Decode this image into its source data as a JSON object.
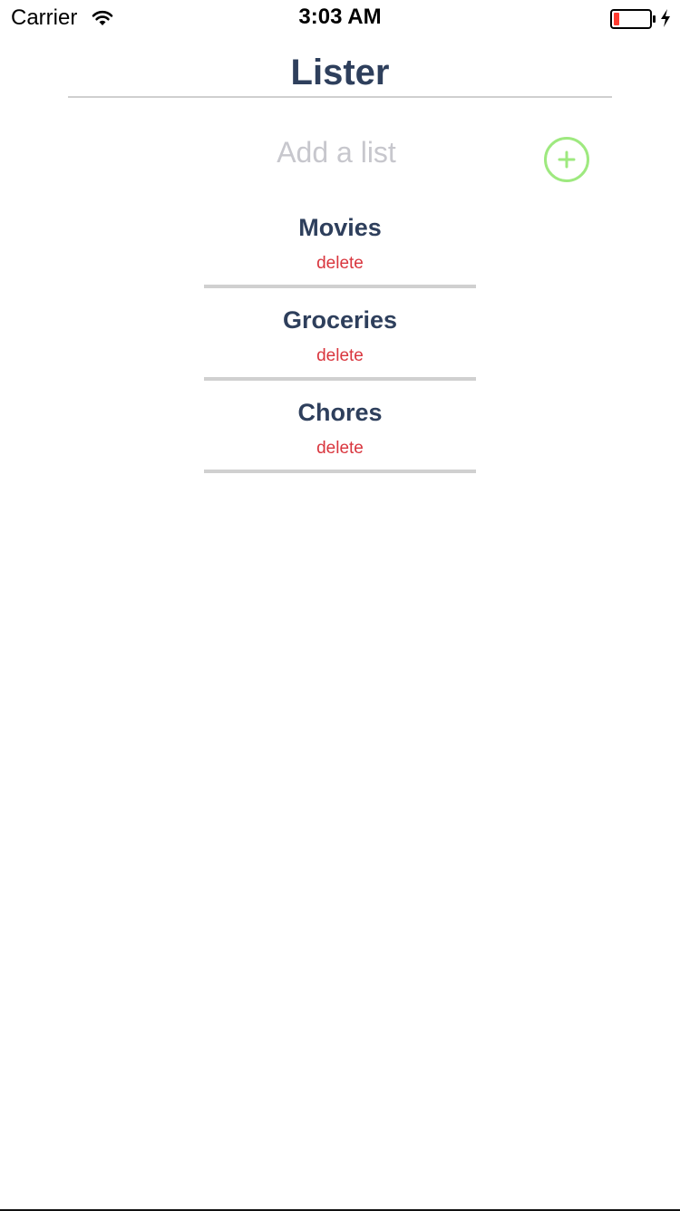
{
  "status_bar": {
    "carrier": "Carrier",
    "time": "3:03 AM",
    "battery_level": 0.15,
    "charging": true
  },
  "app": {
    "title": "Lister"
  },
  "add_list": {
    "placeholder": "Add a list",
    "value": "",
    "icon": "plus-circle-icon"
  },
  "lists": [
    {
      "name": "Movies",
      "delete_label": "delete"
    },
    {
      "name": "Groceries",
      "delete_label": "delete"
    },
    {
      "name": "Chores",
      "delete_label": "delete"
    }
  ],
  "colors": {
    "title": "#2e3f5c",
    "accent_green": "#9ee97f",
    "delete_red": "#d9363e",
    "divider": "#d0d0d0",
    "placeholder": "#c7c7cd"
  }
}
